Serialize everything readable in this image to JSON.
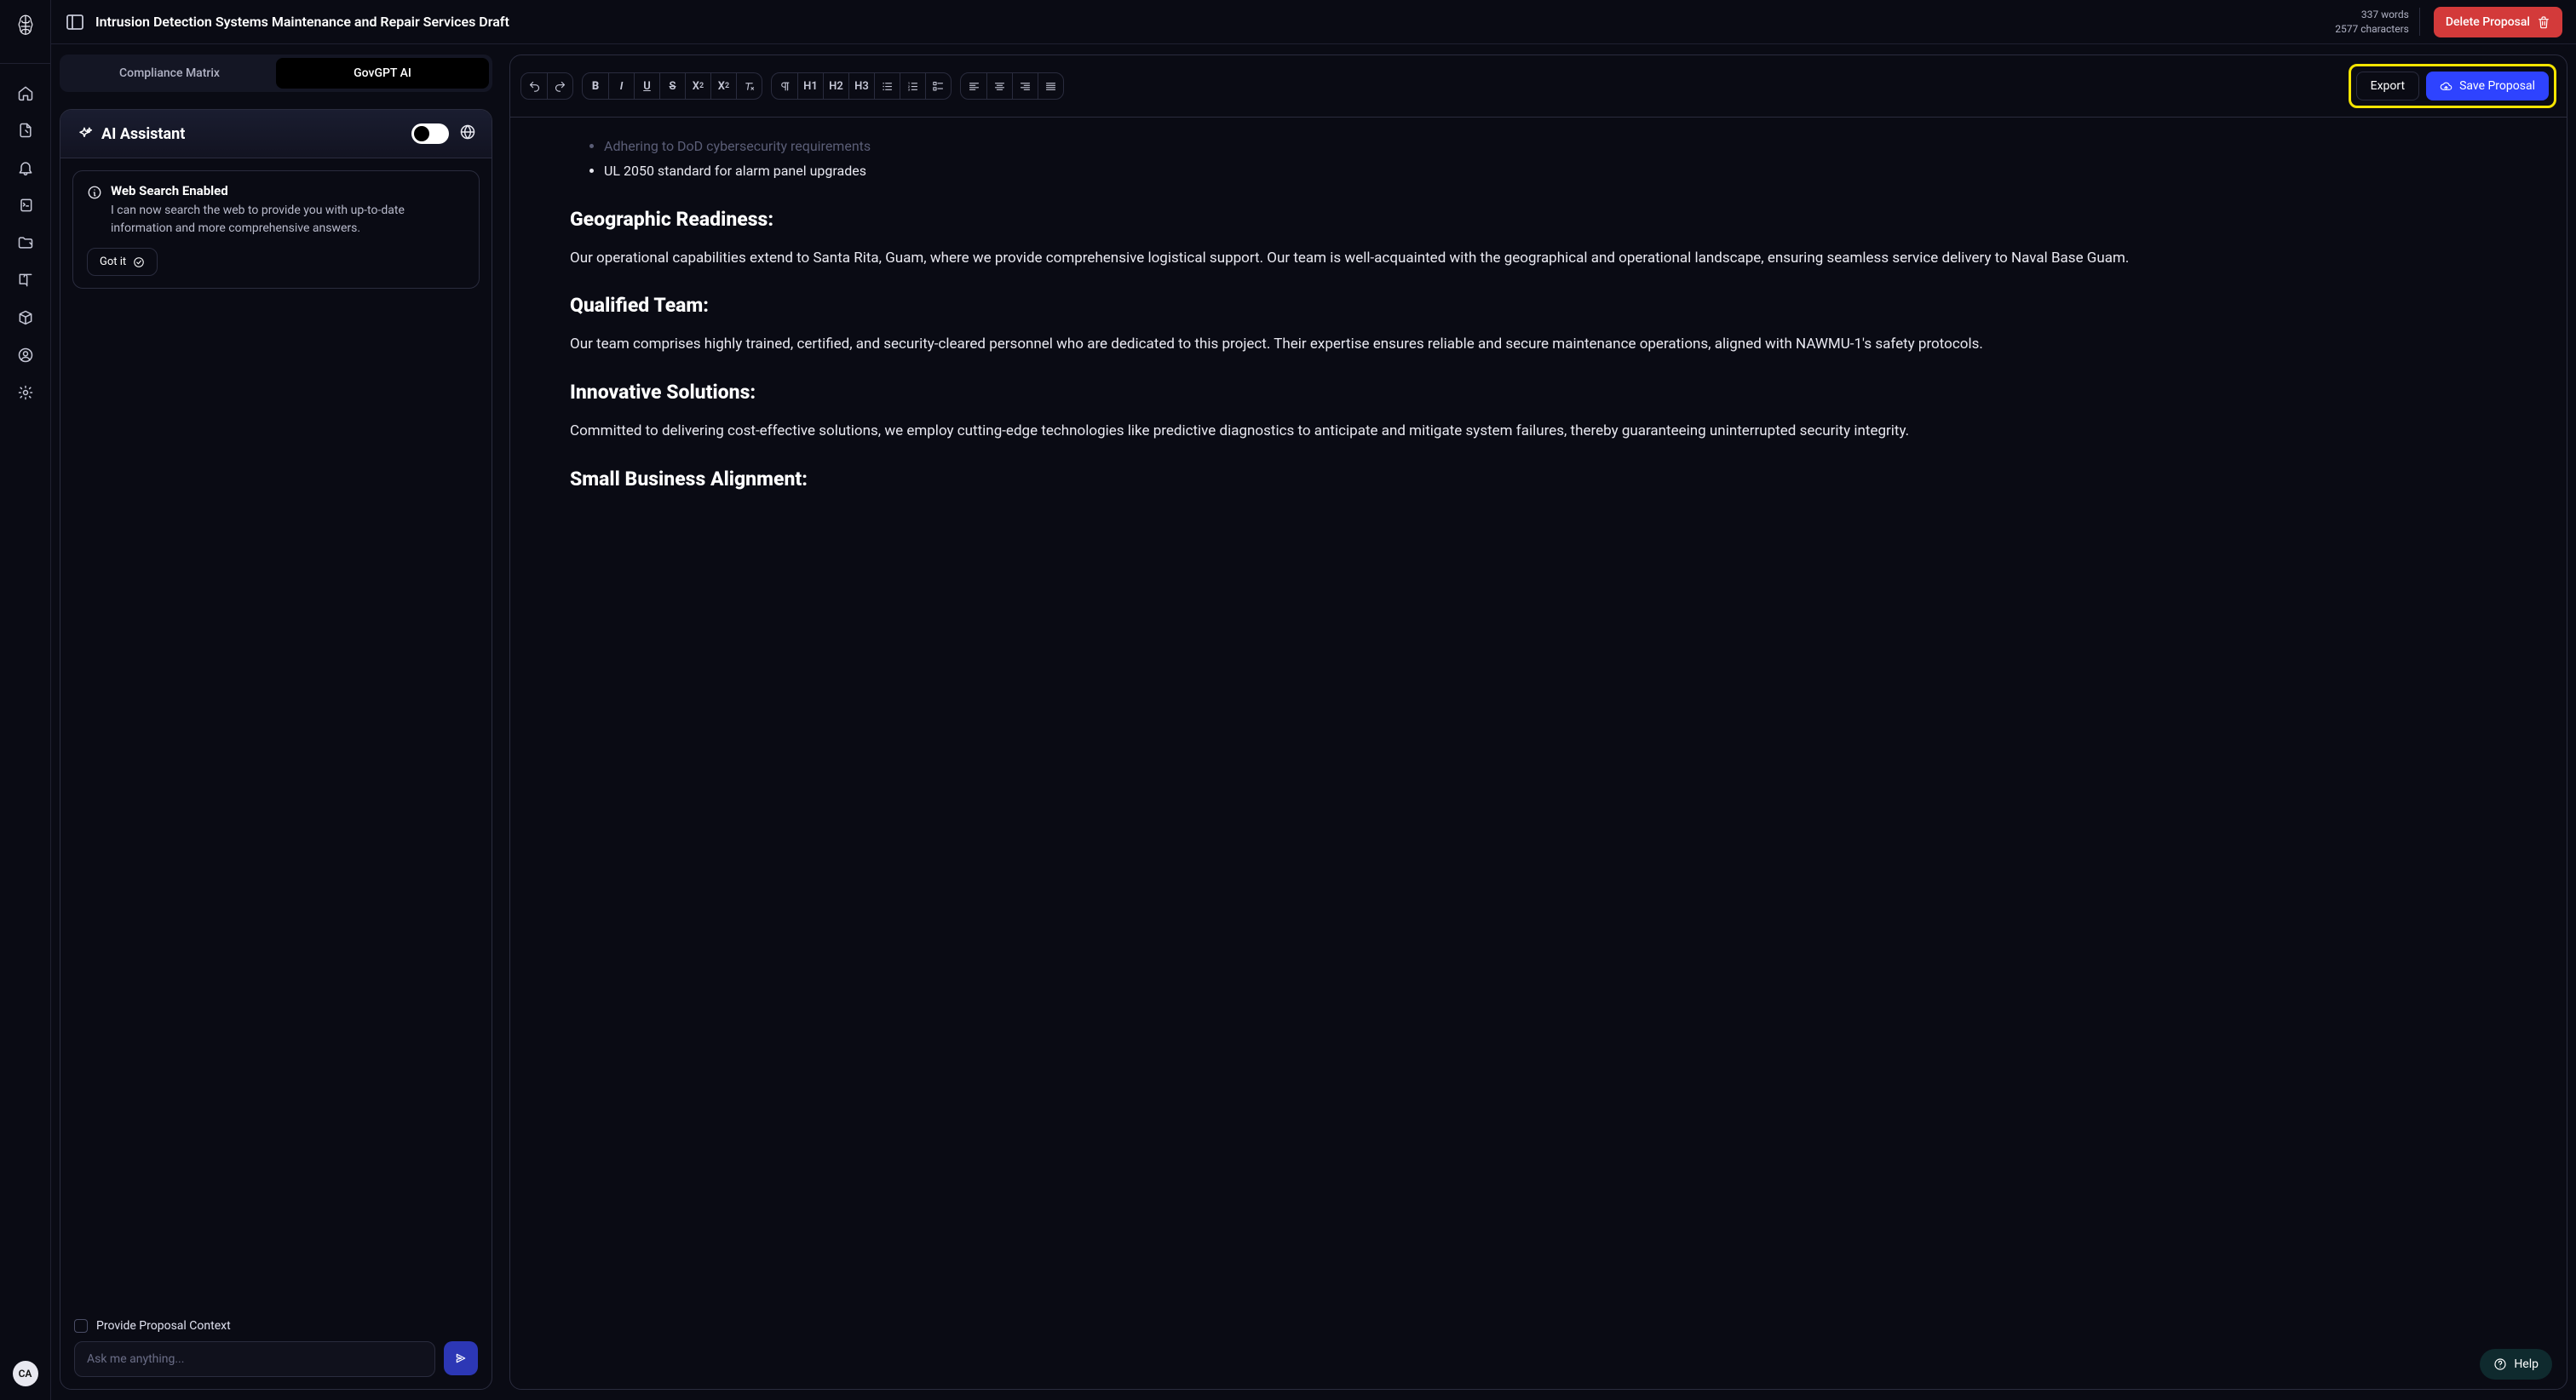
{
  "doc_title": "Intrusion Detection Systems Maintenance and Repair Services Draft",
  "stats": {
    "words": "337 words",
    "chars": "2577 characters"
  },
  "buttons": {
    "delete": "Delete Proposal",
    "export": "Export",
    "save": "Save Proposal",
    "gotit": "Got it",
    "help": "Help"
  },
  "tabs": {
    "compliance": "Compliance Matrix",
    "govgpt": "GovGPT AI"
  },
  "assistant": {
    "title": "AI Assistant",
    "ws_title": "Web Search Enabled",
    "ws_desc": "I can now search the web to provide you with up-to-date information and more comprehensive answers.",
    "ctx_label": "Provide Proposal Context",
    "placeholder": "Ask me anything..."
  },
  "avatar": "CA",
  "content": {
    "bullet1": "Adhering to DoD cybersecurity requirements",
    "bullet2": "UL 2050 standard for alarm panel upgrades",
    "h_geo": "Geographic Readiness:",
    "p_geo": "Our operational capabilities extend to Santa Rita, Guam, where we provide comprehensive logistical support. Our team is well-acquainted with the geographical and operational landscape, ensuring seamless service delivery to Naval Base Guam.",
    "h_team": "Qualified Team:",
    "p_team": "Our team comprises highly trained, certified, and security-cleared personnel who are dedicated to this project. Their expertise ensures reliable and secure maintenance operations, aligned with NAWMU-1's safety protocols.",
    "h_innov": "Innovative Solutions:",
    "p_innov": "Committed to delivering cost-effective solutions, we employ cutting-edge technologies like predictive diagnostics to anticipate and mitigate system failures, thereby guaranteeing uninterrupted security integrity.",
    "h_sba": "Small Business Alignment:"
  },
  "toolbar": {
    "h1": "H1",
    "h2": "H2",
    "h3": "H3"
  },
  "icons": {
    "rail": [
      "home",
      "document",
      "bell",
      "script",
      "folder",
      "book",
      "package",
      "account",
      "settings"
    ]
  }
}
